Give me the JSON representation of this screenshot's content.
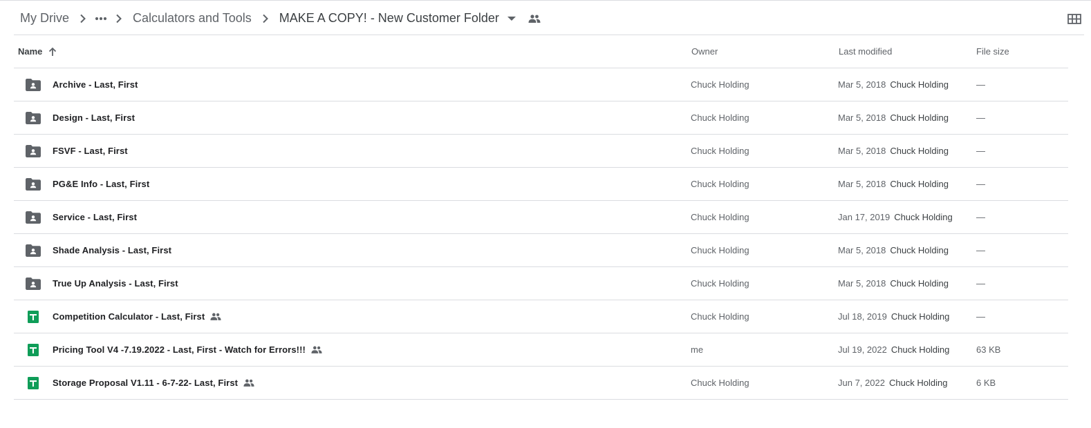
{
  "breadcrumb": {
    "root": "My Drive",
    "parent": "Calculators and Tools",
    "current": "MAKE A COPY! - New Customer Folder"
  },
  "icons": {
    "separator": "chevron-right-icon",
    "overflow": "more-horiz-icon",
    "dropdown": "arrow-drop-down-icon",
    "shared": "people-icon",
    "view": "grid-view-icon",
    "folder": "shared-folder-icon",
    "sheet": "google-sheets-icon",
    "sort": "arrow-up-icon"
  },
  "colors": {
    "folder": "#5f6368",
    "sheets": "#0f9d58",
    "divider": "#dadce0"
  },
  "columns": {
    "name": "Name",
    "owner": "Owner",
    "modified": "Last modified",
    "size": "File size"
  },
  "files": [
    {
      "type": "folder",
      "name": "Archive - Last, First",
      "shared": false,
      "owner": "Chuck Holding",
      "date": "Mar 5, 2018",
      "modified_by": "Chuck Holding",
      "size": "—"
    },
    {
      "type": "folder",
      "name": "Design - Last, First",
      "shared": false,
      "owner": "Chuck Holding",
      "date": "Mar 5, 2018",
      "modified_by": "Chuck Holding",
      "size": "—"
    },
    {
      "type": "folder",
      "name": "FSVF - Last, First",
      "shared": false,
      "owner": "Chuck Holding",
      "date": "Mar 5, 2018",
      "modified_by": "Chuck Holding",
      "size": "—"
    },
    {
      "type": "folder",
      "name": "PG&E Info - Last, First",
      "shared": false,
      "owner": "Chuck Holding",
      "date": "Mar 5, 2018",
      "modified_by": "Chuck Holding",
      "size": "—"
    },
    {
      "type": "folder",
      "name": "Service - Last, First",
      "shared": false,
      "owner": "Chuck Holding",
      "date": "Jan 17, 2019",
      "modified_by": "Chuck Holding",
      "size": "—"
    },
    {
      "type": "folder",
      "name": "Shade Analysis - Last, First",
      "shared": false,
      "owner": "Chuck Holding",
      "date": "Mar 5, 2018",
      "modified_by": "Chuck Holding",
      "size": "—"
    },
    {
      "type": "folder",
      "name": "True Up Analysis - Last, First",
      "shared": false,
      "owner": "Chuck Holding",
      "date": "Mar 5, 2018",
      "modified_by": "Chuck Holding",
      "size": "—"
    },
    {
      "type": "sheet",
      "name": "Competition Calculator - Last, First",
      "shared": true,
      "owner": "Chuck Holding",
      "date": "Jul 18, 2019",
      "modified_by": "Chuck Holding",
      "size": "—"
    },
    {
      "type": "sheet",
      "name": "Pricing Tool V4 -7.19.2022 - Last, First - Watch for Errors!!!",
      "shared": true,
      "owner": "me",
      "date": "Jul 19, 2022",
      "modified_by": "Chuck Holding",
      "size": "63 KB"
    },
    {
      "type": "sheet",
      "name": "Storage Proposal V1.11 - 6-7-22- Last, First",
      "shared": true,
      "owner": "Chuck Holding",
      "date": "Jun 7, 2022",
      "modified_by": "Chuck Holding",
      "size": "6 KB"
    }
  ]
}
